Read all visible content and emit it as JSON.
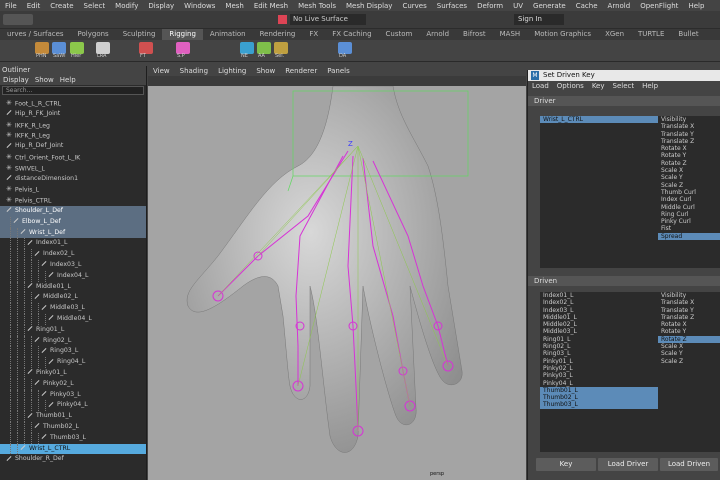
{
  "menubar": [
    "File",
    "Edit",
    "Create",
    "Select",
    "Modify",
    "Display",
    "Windows",
    "Mesh",
    "Edit Mesh",
    "Mesh Tools",
    "Mesh Display",
    "Curves",
    "Surfaces",
    "Deform",
    "UV",
    "Generate",
    "Cache",
    "Arnold",
    "OpenFlight",
    "Help"
  ],
  "toolbar": {
    "live_surface": "No Live Surface",
    "signin": "Sign In"
  },
  "shelf_tabs": [
    "urves / Surfaces",
    "Polygons",
    "Sculpting",
    "Rigging",
    "Animation",
    "Rendering",
    "FX",
    "FX Caching",
    "Custom",
    "Arnold",
    "Bifrost",
    "MASH",
    "Motion Graphics",
    "XGen",
    "TURTLE",
    "Bullet"
  ],
  "shelf_icons": [
    "PHN",
    "SaWi",
    "Hier",
    "LRA",
    "FT",
    "S.P",
    "NE",
    "AA",
    "Sel.",
    "DA"
  ],
  "outliner": {
    "title": "Outliner",
    "menu": [
      "Display",
      "Show",
      "Help"
    ],
    "search": "Search...",
    "rows": [
      {
        "label": "Foot_L_R_CTRL",
        "depth": 1,
        "state": "",
        "icon": "ast"
      },
      {
        "label": "Hip_R_FK_Joint",
        "depth": 1,
        "state": "",
        "icon": "line"
      },
      {
        "label": "IKFK_R_Leg",
        "depth": 1,
        "state": "",
        "icon": "ast"
      },
      {
        "label": "IKFK_R_Leg",
        "depth": 1,
        "state": "",
        "icon": "ast"
      },
      {
        "label": "Hip_R_Def_Joint",
        "depth": 1,
        "state": "",
        "icon": "line"
      },
      {
        "label": "Ctrl_Orient_Foot_L_IK",
        "depth": 1,
        "state": "",
        "icon": "ast"
      },
      {
        "label": "SWIVEL_L",
        "depth": 1,
        "state": "",
        "icon": "ast"
      },
      {
        "label": "distanceDimension1",
        "depth": 1,
        "state": "",
        "icon": "line"
      },
      {
        "label": "Pelvis_L",
        "depth": 1,
        "state": "",
        "icon": "ast"
      },
      {
        "label": "Pelvis_CTRL",
        "depth": 1,
        "state": "",
        "icon": "ast"
      },
      {
        "label": "Shoulder_L_Def",
        "depth": 1,
        "state": "sel",
        "icon": "line"
      },
      {
        "label": "Elbow_L_Def",
        "depth": 2,
        "state": "sel",
        "icon": "line"
      },
      {
        "label": "Wrist_L_Def",
        "depth": 3,
        "state": "sel",
        "icon": "line"
      },
      {
        "label": "Index01_L",
        "depth": 4,
        "state": "",
        "icon": "line"
      },
      {
        "label": "Index02_L",
        "depth": 5,
        "state": "",
        "icon": "line"
      },
      {
        "label": "Index03_L",
        "depth": 6,
        "state": "",
        "icon": "line"
      },
      {
        "label": "Index04_L",
        "depth": 7,
        "state": "",
        "icon": "line"
      },
      {
        "label": "Middle01_L",
        "depth": 4,
        "state": "",
        "icon": "line"
      },
      {
        "label": "Middle02_L",
        "depth": 5,
        "state": "",
        "icon": "line"
      },
      {
        "label": "Middle03_L",
        "depth": 6,
        "state": "",
        "icon": "line"
      },
      {
        "label": "Middle04_L",
        "depth": 7,
        "state": "",
        "icon": "line"
      },
      {
        "label": "Ring01_L",
        "depth": 4,
        "state": "",
        "icon": "line"
      },
      {
        "label": "Ring02_L",
        "depth": 5,
        "state": "",
        "icon": "line"
      },
      {
        "label": "Ring03_L",
        "depth": 6,
        "state": "",
        "icon": "line"
      },
      {
        "label": "Ring04_L",
        "depth": 7,
        "state": "",
        "icon": "line"
      },
      {
        "label": "Pinky01_L",
        "depth": 4,
        "state": "",
        "icon": "line"
      },
      {
        "label": "Pinky02_L",
        "depth": 5,
        "state": "",
        "icon": "line"
      },
      {
        "label": "Pinky03_L",
        "depth": 6,
        "state": "",
        "icon": "line"
      },
      {
        "label": "Pinky04_L",
        "depth": 7,
        "state": "",
        "icon": "line"
      },
      {
        "label": "Thumb01_L",
        "depth": 4,
        "state": "",
        "icon": "line"
      },
      {
        "label": "Thumb02_L",
        "depth": 5,
        "state": "",
        "icon": "line"
      },
      {
        "label": "Thumb03_L",
        "depth": 6,
        "state": "",
        "icon": "line"
      },
      {
        "label": "Wrist_L_CTRL",
        "depth": 3,
        "state": "bar",
        "icon": "line"
      },
      {
        "label": "Shoulder_R_Def",
        "depth": 1,
        "state": "",
        "icon": "line"
      }
    ]
  },
  "viewport": {
    "menu": [
      "View",
      "Shading",
      "Lighting",
      "Show",
      "Renderer",
      "Panels"
    ],
    "camera": "persp"
  },
  "sdk": {
    "title": "Set Driven Key",
    "menu": [
      "Load",
      "Options",
      "Key",
      "Select",
      "Help"
    ],
    "driver_label": "Driver",
    "driven_label": "Driven",
    "driver_objects": [
      {
        "t": "Wrist_L_CTRL",
        "h": true
      }
    ],
    "driver_attrs": [
      {
        "t": "Visibility",
        "h": false
      },
      {
        "t": "Translate X",
        "h": false
      },
      {
        "t": "Translate Y",
        "h": false
      },
      {
        "t": "Translate Z",
        "h": false
      },
      {
        "t": "Rotate X",
        "h": false
      },
      {
        "t": "Rotate Y",
        "h": false
      },
      {
        "t": "Rotate Z",
        "h": false
      },
      {
        "t": "Scale X",
        "h": false
      },
      {
        "t": "Scale Y",
        "h": false
      },
      {
        "t": "Scale Z",
        "h": false
      },
      {
        "t": "Thumb Curl",
        "h": false
      },
      {
        "t": "Index Curl",
        "h": false
      },
      {
        "t": "Middle Curl",
        "h": false
      },
      {
        "t": "Ring Curl",
        "h": false
      },
      {
        "t": "Pinky Curl",
        "h": false
      },
      {
        "t": "Fist",
        "h": false
      },
      {
        "t": "Spread",
        "h": true
      }
    ],
    "driven_objects": [
      {
        "t": "Index01_L",
        "h": false
      },
      {
        "t": "Index02_L",
        "h": false
      },
      {
        "t": "Index03_L",
        "h": false
      },
      {
        "t": "Middle01_L",
        "h": false
      },
      {
        "t": "Middle02_L",
        "h": false
      },
      {
        "t": "Middle03_L",
        "h": false
      },
      {
        "t": "Ring01_L",
        "h": false
      },
      {
        "t": "Ring02_L",
        "h": false
      },
      {
        "t": "Ring03_L",
        "h": false
      },
      {
        "t": "Pinky01_L",
        "h": false
      },
      {
        "t": "Pinky02_L",
        "h": false
      },
      {
        "t": "Pinky03_L",
        "h": false
      },
      {
        "t": "Pinky04_L",
        "h": false
      },
      {
        "t": "Thumb01_L",
        "h": true
      },
      {
        "t": "Thumb02_L",
        "h": true
      },
      {
        "t": "Thumb03_L",
        "h": true
      }
    ],
    "driven_attrs": [
      {
        "t": "Visibility",
        "h": false
      },
      {
        "t": "Translate X",
        "h": false
      },
      {
        "t": "Translate Y",
        "h": false
      },
      {
        "t": "Translate Z",
        "h": false
      },
      {
        "t": "Rotate X",
        "h": false
      },
      {
        "t": "Rotate Y",
        "h": false
      },
      {
        "t": "Rotate Z",
        "h": true
      },
      {
        "t": "Scale X",
        "h": false
      },
      {
        "t": "Scale Y",
        "h": false
      },
      {
        "t": "Scale Z",
        "h": false
      }
    ],
    "buttons": [
      "Key",
      "Load Driver",
      "Load Driven"
    ]
  }
}
